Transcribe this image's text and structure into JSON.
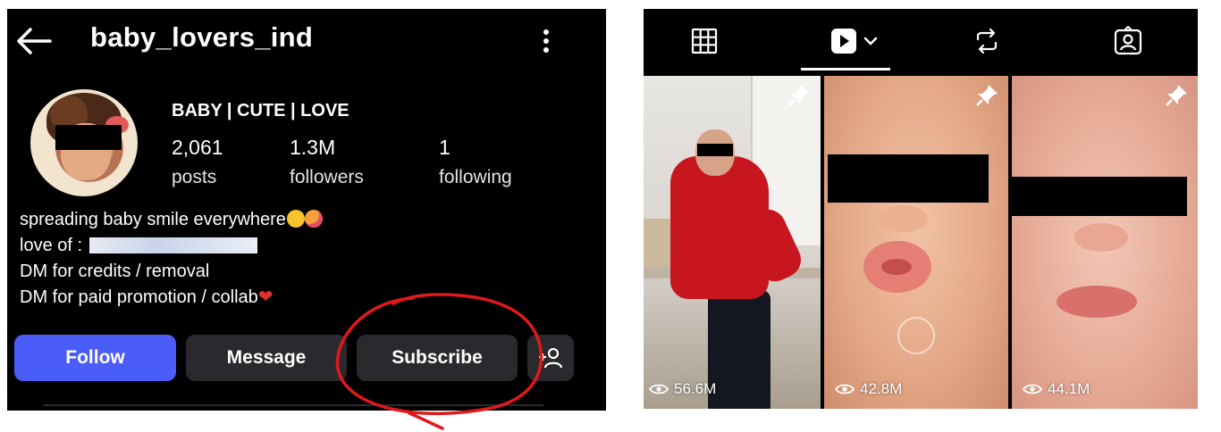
{
  "profile": {
    "username": "baby_lovers_ind",
    "category": "BABY | CUTE | LOVE",
    "stats": [
      {
        "value": "2,061",
        "label": "posts"
      },
      {
        "value": "1.3M",
        "label": "followers"
      },
      {
        "value": "1",
        "label": "following"
      }
    ],
    "bio": {
      "line1": "spreading baby smile everywhere",
      "line2": "love of :",
      "line3": "DM for credits / removal",
      "line4": "DM for paid promotion / collab"
    }
  },
  "actions": {
    "follow": "Follow",
    "message": "Message",
    "subscribe": "Subscribe"
  },
  "tabs": [
    "grid-tab",
    "reels-tab",
    "reposts-tab",
    "tagged-tab"
  ],
  "reels": [
    {
      "views": "56.6M"
    },
    {
      "views": "42.8M"
    },
    {
      "views": "44.1M"
    }
  ],
  "colors": {
    "follow_button": "#4a5df9",
    "secondary_button": "#2a2a2e",
    "annotation": "#e0191c",
    "background": "#000000"
  },
  "icons": [
    "back-arrow-icon",
    "more-vertical-icon",
    "add-user-icon",
    "grid-icon",
    "reels-icon",
    "chevron-down-icon",
    "repost-icon",
    "tagged-icon",
    "pin-icon",
    "eye-icon"
  ]
}
